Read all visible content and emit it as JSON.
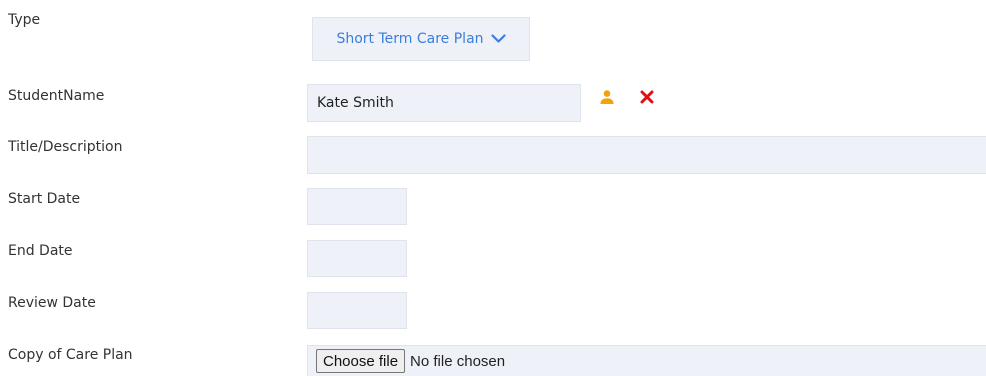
{
  "form": {
    "type": {
      "label": "Type",
      "selected": "Short Term Care Plan"
    },
    "student_name": {
      "label": "StudentName",
      "value": "Kate Smith"
    },
    "title_description": {
      "label": "Title/Description",
      "value": ""
    },
    "start_date": {
      "label": "Start Date",
      "value": ""
    },
    "end_date": {
      "label": "End Date",
      "value": ""
    },
    "review_date": {
      "label": "Review Date",
      "value": ""
    },
    "copy_of_care_plan": {
      "label": "Copy of Care Plan",
      "button_label": "Choose file",
      "status": "No file chosen"
    }
  },
  "icons": {
    "select_student": "person-icon",
    "clear_student": "close-icon",
    "dropdown": "chevron-down-icon"
  },
  "colors": {
    "accent_blue": "#3b7ddd",
    "person_icon": "#f0a30a",
    "close_icon": "#e01010",
    "field_bg": "#eef2f8"
  }
}
